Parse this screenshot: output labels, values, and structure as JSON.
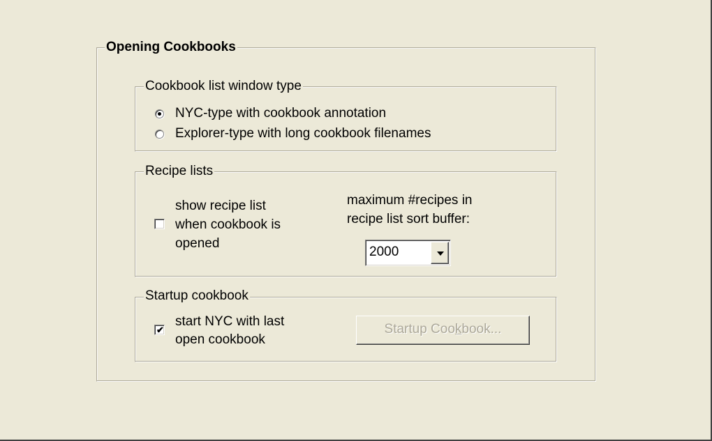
{
  "opening": {
    "title": "Opening Cookbooks",
    "list_type": {
      "title": "Cookbook list window type",
      "options": [
        {
          "label": "NYC-type with cookbook annotation",
          "checked": true
        },
        {
          "label": "Explorer-type with long cookbook filenames",
          "checked": false
        }
      ]
    },
    "recipe_lists": {
      "title": "Recipe lists",
      "show_label_line1": "show recipe list",
      "show_label_line2": "when cookbook is",
      "show_label_line3": "opened",
      "show_checked": false,
      "max_label_line1": "maximum #recipes in",
      "max_label_line2": "recipe list sort buffer:",
      "max_value": "2000"
    },
    "startup": {
      "title": "Startup cookbook",
      "check_label_line1": "start NYC with last",
      "check_label_line2": "open cookbook",
      "checked": true,
      "button_pre": "Startup Coo",
      "button_mnemonic": "k",
      "button_post": "book..."
    }
  }
}
